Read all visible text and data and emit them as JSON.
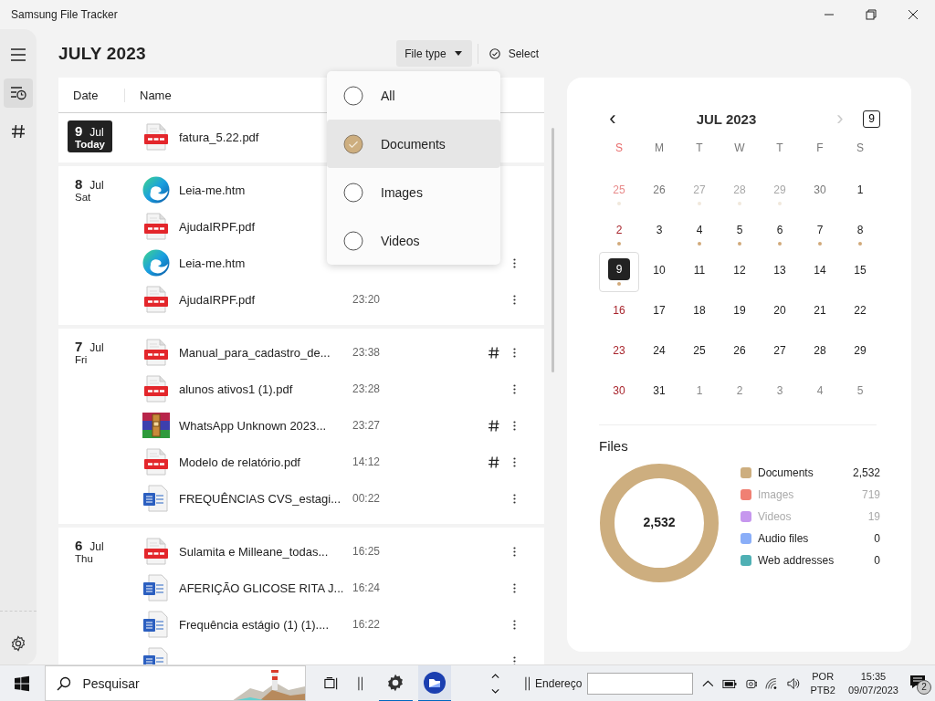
{
  "window": {
    "title": "Samsung File Tracker"
  },
  "sidebar": {
    "items": [
      {
        "kind": "menu",
        "selected": false
      },
      {
        "kind": "history",
        "selected": true
      },
      {
        "kind": "tags",
        "selected": false
      }
    ]
  },
  "header": {
    "title": "JULY 2023",
    "filter_button": "File type",
    "select_button": "Select"
  },
  "table": {
    "columns": [
      "Date",
      "Name"
    ],
    "groups": [
      {
        "day": "9",
        "month": "Jul",
        "weekday": "Today",
        "today": true,
        "files": [
          {
            "kind": "pdf",
            "name": "fatura_5.22.pdf"
          }
        ]
      },
      {
        "day": "8",
        "month": "Jul",
        "weekday": "Sat",
        "today": false,
        "files": [
          {
            "kind": "edge",
            "name": "Leia-me.htm"
          },
          {
            "kind": "pdf",
            "name": "AjudaIRPF.pdf"
          },
          {
            "kind": "edge",
            "name": "Leia-me.htm",
            "menu": true
          },
          {
            "kind": "pdf",
            "name": "AjudaIRPF.pdf",
            "time": "23:20",
            "menu": true
          }
        ]
      },
      {
        "day": "7",
        "month": "Jul",
        "weekday": "Fri",
        "today": false,
        "files": [
          {
            "kind": "pdf",
            "name": "Manual_para_cadastro_de...",
            "time": "23:38",
            "tagged": true,
            "menu": true
          },
          {
            "kind": "pdf",
            "name": "alunos ativos1 (1).pdf",
            "time": "23:28",
            "tagged": false,
            "menu": true
          },
          {
            "kind": "rar",
            "name": "WhatsApp Unknown 2023...",
            "time": "23:27",
            "tagged": true,
            "menu": true
          },
          {
            "kind": "pdf",
            "name": "Modelo de relatório.pdf",
            "time": "14:12",
            "tagged": true,
            "menu": true
          },
          {
            "kind": "word",
            "name": "FREQUÊNCIAS CVS_estagi...",
            "time": "00:22",
            "tagged": false,
            "menu": true
          }
        ]
      },
      {
        "day": "6",
        "month": "Jul",
        "weekday": "Thu",
        "today": false,
        "files": [
          {
            "kind": "pdf",
            "name": "Sulamita e Milleane_todas...",
            "time": "16:25",
            "tagged": false,
            "menu": true
          },
          {
            "kind": "word",
            "name": "AFERIÇÃO GLICOSE RITA J...",
            "time": "16:24",
            "tagged": false,
            "menu": true
          },
          {
            "kind": "word",
            "name": "Frequência estágio (1) (1)....",
            "time": "16:22",
            "tagged": false,
            "menu": true
          },
          {
            "kind": "word",
            "menu": true
          }
        ]
      }
    ]
  },
  "file_type_menu": [
    {
      "label": "All",
      "selected": false
    },
    {
      "label": "Documents",
      "selected": true
    },
    {
      "label": "Images",
      "selected": false
    },
    {
      "label": "Videos",
      "selected": false
    }
  ],
  "calendar": {
    "prev": "‹",
    "title": "JUL 2023",
    "next": "›",
    "next_disabled": true,
    "today_button": "9",
    "weekdays": [
      "S",
      "M",
      "T",
      "W",
      "T",
      "F",
      "S"
    ],
    "days": [
      {
        "day": "25",
        "kind": "prev",
        "has_files": true
      },
      {
        "day": "26",
        "kind": "prev"
      },
      {
        "day": "27",
        "kind": "faint",
        "has_files": true
      },
      {
        "day": "28",
        "kind": "faint",
        "has_files": true
      },
      {
        "day": "29",
        "kind": "faint",
        "has_files": true
      },
      {
        "day": "30",
        "kind": "prev"
      },
      {
        "day": "1",
        "kind": "current"
      },
      {
        "day": "2",
        "kind": "current",
        "has_files": true
      },
      {
        "day": "3",
        "kind": "current"
      },
      {
        "day": "4",
        "kind": "current",
        "has_files": true
      },
      {
        "day": "5",
        "kind": "current",
        "has_files": true
      },
      {
        "day": "6",
        "kind": "current",
        "has_files": true
      },
      {
        "day": "7",
        "kind": "current",
        "has_files": true
      },
      {
        "day": "8",
        "kind": "current",
        "has_files": true
      },
      {
        "day": "9",
        "kind": "current",
        "has_files": true,
        "selected": true
      },
      {
        "day": "10",
        "kind": "current"
      },
      {
        "day": "11",
        "kind": "current"
      },
      {
        "day": "12",
        "kind": "current"
      },
      {
        "day": "13",
        "kind": "current"
      },
      {
        "day": "14",
        "kind": "current"
      },
      {
        "day": "15",
        "kind": "current"
      },
      {
        "day": "16",
        "kind": "current"
      },
      {
        "day": "17",
        "kind": "current"
      },
      {
        "day": "18",
        "kind": "current"
      },
      {
        "day": "19",
        "kind": "current"
      },
      {
        "day": "20",
        "kind": "current"
      },
      {
        "day": "21",
        "kind": "current"
      },
      {
        "day": "22",
        "kind": "current"
      },
      {
        "day": "23",
        "kind": "current"
      },
      {
        "day": "24",
        "kind": "current"
      },
      {
        "day": "25",
        "kind": "current"
      },
      {
        "day": "26",
        "kind": "current"
      },
      {
        "day": "27",
        "kind": "current"
      },
      {
        "day": "28",
        "kind": "current"
      },
      {
        "day": "29",
        "kind": "current"
      },
      {
        "day": "30",
        "kind": "current"
      },
      {
        "day": "31",
        "kind": "current"
      },
      {
        "day": "1",
        "kind": "next"
      },
      {
        "day": "2",
        "kind": "next"
      },
      {
        "day": "3",
        "kind": "next"
      },
      {
        "day": "4",
        "kind": "next"
      },
      {
        "day": "5",
        "kind": "next"
      }
    ]
  },
  "files_summary": {
    "title": "Files",
    "total": "2,532",
    "legend": [
      {
        "label": "Documents",
        "count": "2,532",
        "color": "#cdae7f",
        "dimmed": false
      },
      {
        "label": "Images",
        "count": "719",
        "color": "#f08073",
        "dimmed": true
      },
      {
        "label": "Videos",
        "count": "19",
        "color": "#c697ee",
        "dimmed": true
      },
      {
        "label": "Audio files",
        "count": "0",
        "color": "#8aaef8",
        "dimmed": false
      },
      {
        "label": "Web addresses",
        "count": "0",
        "color": "#4fb0b4",
        "dimmed": false
      }
    ]
  },
  "taskbar": {
    "search_placeholder": "Pesquisar",
    "address_label": "Endereço",
    "language": "POR",
    "layout": "PTB2",
    "time": "15:35",
    "date": "09/07/2023",
    "notifications": "2"
  }
}
